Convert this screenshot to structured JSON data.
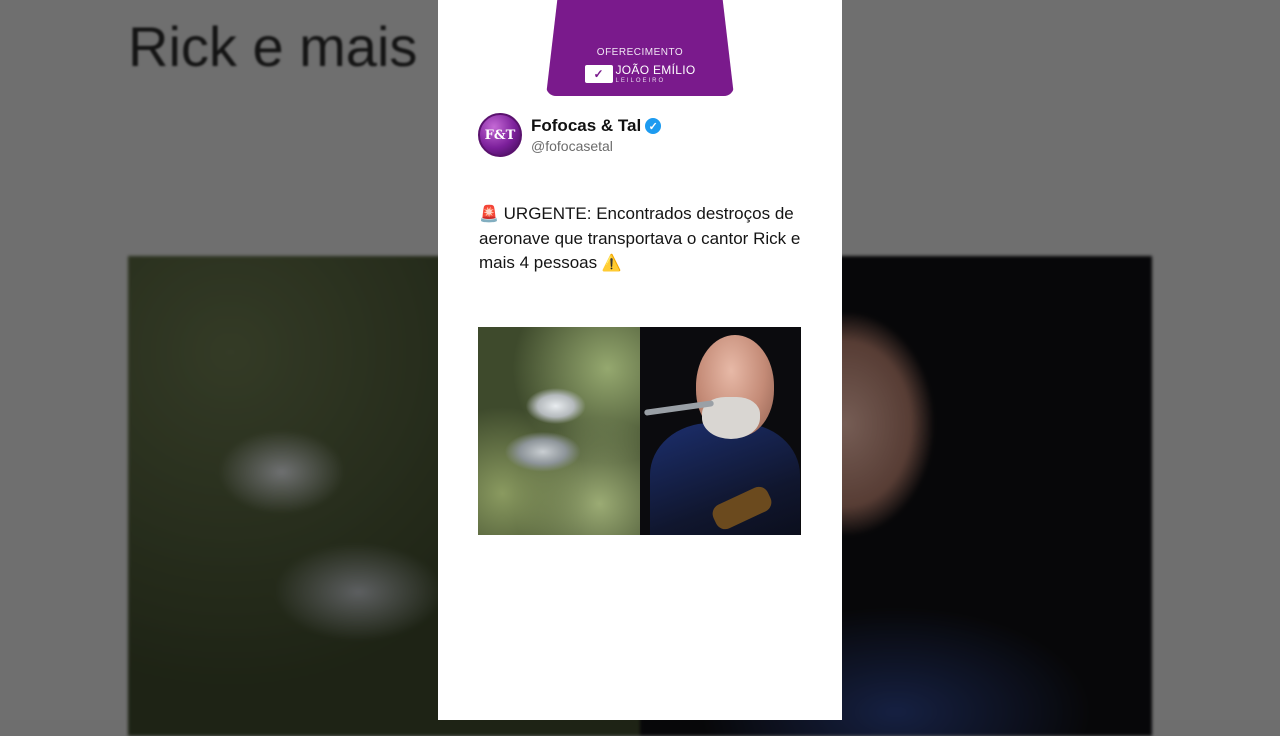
{
  "background": {
    "text_fragment": "Rick e mais"
  },
  "sponsor": {
    "label": "OFERECIMENTO",
    "brand": "JOÃO EMÍLIO",
    "subtitle": "LEILOEIRO",
    "logo_icon": "signature-logo-icon",
    "color": "#7a1a8c"
  },
  "post": {
    "display_name": "Fofocas & Tal",
    "handle": "@fofocasetal",
    "avatar_text": "F&T",
    "verified": true,
    "verified_color": "#1d9bf0",
    "text": "URGENTE: Encontrados destroços de aeronave que transportava o cantor Rick e mais 4 pessoas",
    "leading_emoji": "🚨",
    "trailing_emoji": "⚠️",
    "media": [
      {
        "kind": "photo",
        "subject": "wreckage-photo"
      },
      {
        "kind": "photo",
        "subject": "singer-photo"
      }
    ]
  }
}
